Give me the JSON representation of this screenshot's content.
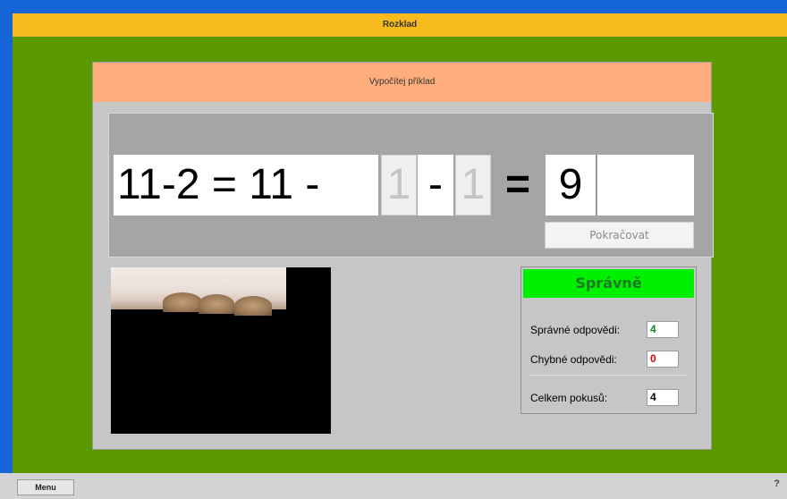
{
  "app": {
    "title": "Rozklad"
  },
  "task": {
    "header": "Vypočítej příklad"
  },
  "equation": {
    "expression": "11-2 = 11 -",
    "slot1": "1",
    "minus": "-",
    "slot2": "1",
    "equals": "=",
    "answer1": "9",
    "answer2": ""
  },
  "buttons": {
    "continue": "Pokračovat",
    "menu": "Menu",
    "help": "?"
  },
  "result": {
    "status": "Správně",
    "correct_label": "Správné odpovědi:",
    "correct_value": "4",
    "wrong_label": "Chybné odpovědi:",
    "wrong_value": "0",
    "total_label": "Celkem pokusů:",
    "total_value": "4"
  },
  "colors": {
    "titlebar": "#f7bb1e",
    "stage": "#5a9a00",
    "status_ok": "#00f100",
    "correct": "#0a8a1a",
    "wrong": "#e60000"
  }
}
